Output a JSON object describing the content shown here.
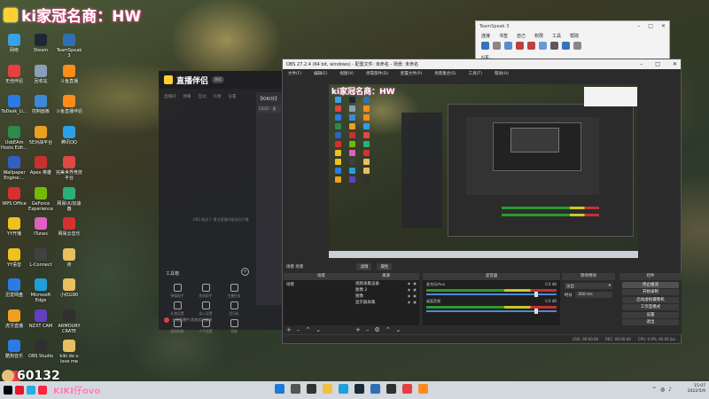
{
  "overlay": {
    "stream_title": "ki家冠名商：HW",
    "viewer_count": "60132",
    "streamer_name": "KIKI仔ovo"
  },
  "desktop_icons": [
    {
      "label": "网络",
      "color": "#3aa0e8"
    },
    {
      "label": "Steam",
      "color": "#1b2838"
    },
    {
      "label": "TeamSpeak 3",
      "color": "#2f6fb5"
    },
    {
      "label": "无他伴侣",
      "color": "#e84040"
    },
    {
      "label": "回收站",
      "color": "#8aa0b8"
    },
    {
      "label": "斗鱼直播",
      "color": "#ff8c1a"
    },
    {
      "label": "ToDesk_Li...",
      "color": "#2a7be4"
    },
    {
      "label": "控制面板",
      "color": "#3a8ad8"
    },
    {
      "label": "斗鱼直播伴侣",
      "color": "#ff8c1a"
    },
    {
      "label": "UsbEAm Hosts Edit...",
      "color": "#2c8a4a"
    },
    {
      "label": "5E对战平台",
      "color": "#e8a020"
    },
    {
      "label": "腾讯QQ",
      "color": "#2aa0e8"
    },
    {
      "label": "Wallpaper Engine:...",
      "color": "#3060c0"
    },
    {
      "label": "Apex 英雄",
      "color": "#c83030"
    },
    {
      "label": "完美世界竞技平台",
      "color": "#e04848"
    },
    {
      "label": "WPS Office",
      "color": "#d83030"
    },
    {
      "label": "GeForce Experience",
      "color": "#76b900"
    },
    {
      "label": "网易UU加速器",
      "color": "#2ab07a"
    },
    {
      "label": "YY开播",
      "color": "#f0c020"
    },
    {
      "label": "iTunes",
      "color": "#e060c0"
    },
    {
      "label": "网易云音乐",
      "color": "#d83030"
    },
    {
      "label": "YY语音",
      "color": "#f0c020"
    },
    {
      "label": "L-Connect",
      "color": "#404040"
    },
    {
      "label": "夜",
      "color": "#e8c060"
    },
    {
      "label": "迅雷网盘",
      "color": "#2a7be4"
    },
    {
      "label": "Microsoft Edge",
      "color": "#1fa0d8"
    },
    {
      "label": "小红G90",
      "color": "#e8c060"
    },
    {
      "label": "虎牙直播",
      "color": "#f0a020"
    },
    {
      "label": "NZXT CAM",
      "color": "#6040c0"
    },
    {
      "label": "ARMOURY CRATE",
      "color": "#303030"
    },
    {
      "label": "酷狗音乐",
      "color": "#2a7be4"
    },
    {
      "label": "OBS Studio",
      "color": "#303030"
    },
    {
      "label": "kiki do u love me",
      "color": "#e8c060"
    },
    {
      "label": "金网K歌",
      "color": "#e84040"
    }
  ],
  "zbbl": {
    "app_name": "直播伴侣",
    "version": "测试",
    "tabs": [
      "直播间",
      "弹幕",
      "互动",
      "礼物",
      "设置"
    ],
    "side_title": "【KiKi仔】",
    "side_box": "CSGO · 直",
    "placeholder": "OBS 推流下  需当直播间推流后开播",
    "tools_label": "工具箱",
    "tools": [
      "弹幕助手",
      "贵宾助手",
      "主播任务",
      "礼物设置",
      "录入设置",
      "音乐机",
      "虚拟形象",
      "人气设置",
      "音量"
    ],
    "footer": "主播直播中,状态实时监测"
  },
  "teamspeak": {
    "title": "TeamSpeak 3",
    "menu": [
      "连接",
      "书签",
      "自己",
      "权限",
      "工具",
      "帮助"
    ],
    "tree_label": "Ki家..."
  },
  "obs": {
    "title": "OBS 27.2.4 (64 bit, windows) - 配置文件: 未命名 - 场景: 未命名",
    "menu": [
      "文件(F)",
      "编辑(E)",
      "视图(V)",
      "停靠部件(D)",
      "配置文件(P)",
      "场景集合(S)",
      "工具(T)",
      "帮助(H)"
    ],
    "scene_label": "场景 场景",
    "scene_tabs": [
      "滤镜",
      "属性"
    ],
    "docks": {
      "scenes": "场景",
      "sources": "来源",
      "mixer": "混音器",
      "transitions": "转场特效",
      "controls": "控件"
    },
    "scenes": [
      "场景"
    ],
    "sources": [
      "视频采集设备",
      "图像 2",
      "图像",
      "显示器采集"
    ],
    "mixer_channels": [
      {
        "name": "麦克风/Aux",
        "db": "0.0 dB"
      },
      {
        "name": "桌面音频",
        "db": "0.0 dB"
      }
    ],
    "transition": "淡出",
    "duration_label": "时长",
    "duration_value": "300 ms",
    "controls": [
      "停止推流",
      "开始录制",
      "启动虚拟摄像机",
      "工作室模式",
      "设置",
      "退出"
    ],
    "status": [
      "LIVE: 00:00:00",
      "REC: 00:00:00",
      "CPU: 0.9%, 60.00 fps"
    ]
  },
  "clock": {
    "time": "15:07",
    "date": "2022/5/9"
  }
}
